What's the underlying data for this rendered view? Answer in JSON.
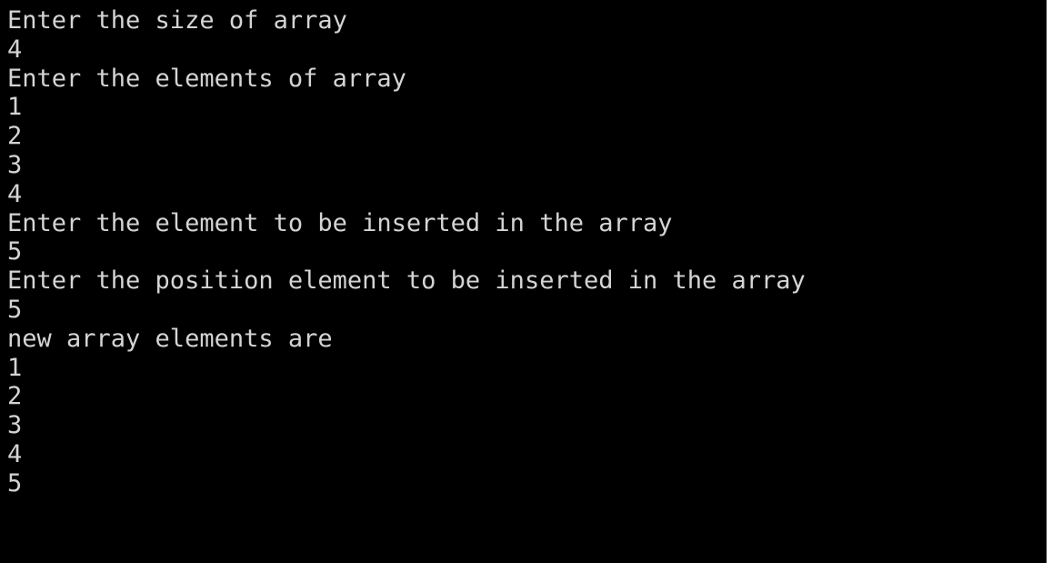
{
  "console": {
    "lines": [
      "Enter the size of array",
      "4",
      "Enter the elements of array",
      "1",
      "2",
      "3",
      "4",
      "Enter the element to be inserted in the array",
      "5",
      "Enter the position element to be inserted in the array",
      "5",
      "new array elements are",
      "1",
      "2",
      "3",
      "4",
      "5"
    ]
  }
}
